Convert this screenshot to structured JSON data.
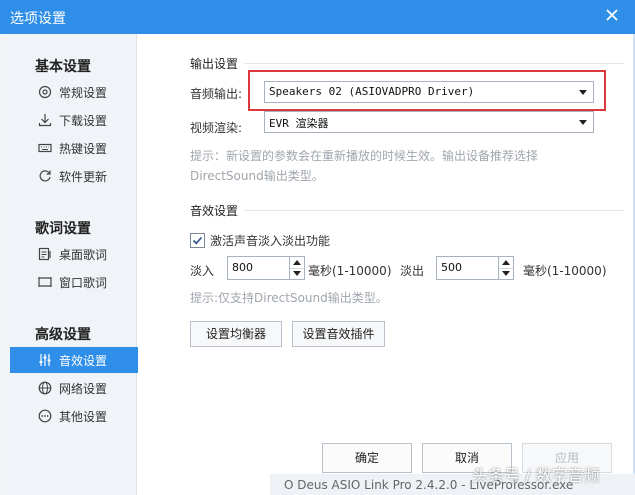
{
  "window": {
    "title": "选项设置"
  },
  "sidebar": {
    "sections": [
      {
        "title": "基本设置",
        "items": [
          {
            "label": "常规设置",
            "icon": "general-settings-icon"
          },
          {
            "label": "下载设置",
            "icon": "download-icon"
          },
          {
            "label": "热键设置",
            "icon": "keyboard-icon"
          },
          {
            "label": "软件更新",
            "icon": "update-icon"
          }
        ]
      },
      {
        "title": "歌词设置",
        "items": [
          {
            "label": "桌面歌词",
            "icon": "desktop-lyrics-icon"
          },
          {
            "label": "窗口歌词",
            "icon": "window-lyrics-icon"
          }
        ]
      },
      {
        "title": "高级设置",
        "items": [
          {
            "label": "音效设置",
            "icon": "equalizer-icon",
            "active": true
          },
          {
            "label": "网络设置",
            "icon": "network-icon"
          },
          {
            "label": "其他设置",
            "icon": "more-icon"
          }
        ]
      }
    ]
  },
  "output": {
    "title": "输出设置",
    "audio_label": "音频输出:",
    "audio_value": "Speakers 02 (ASIOVADPRO Driver)",
    "video_label": "视频渲染:",
    "video_value": "EVR 渲染器",
    "hint": "提示：新设置的参数会在重新播放的时候生效。输出设备推荐选择DirectSound输出类型。"
  },
  "effects": {
    "title": "音效设置",
    "crossfade_label": "激活声音淡入淡出功能",
    "crossfade_checked": true,
    "fadein_label": "淡入",
    "fadein_value": "800",
    "fadein_unit": "毫秒(1-10000)",
    "fadeout_label": "淡出",
    "fadeout_value": "500",
    "fadeout_unit": "毫秒(1-10000)",
    "hint": "提示:仅支持DirectSound输出类型。",
    "eq_button": "设置均衡器",
    "plugin_button": "设置音效插件"
  },
  "footer": {
    "ok": "确定",
    "cancel": "取消",
    "apply": "应用"
  },
  "taskbar": {
    "status": "O Deus ASIO Link Pro 2.4.2.0 - LiveProfessor.exe"
  },
  "watermark": "头条号 / 数字音频",
  "colors": {
    "accent": "#2e8ee8",
    "highlight": "#d9393b"
  }
}
